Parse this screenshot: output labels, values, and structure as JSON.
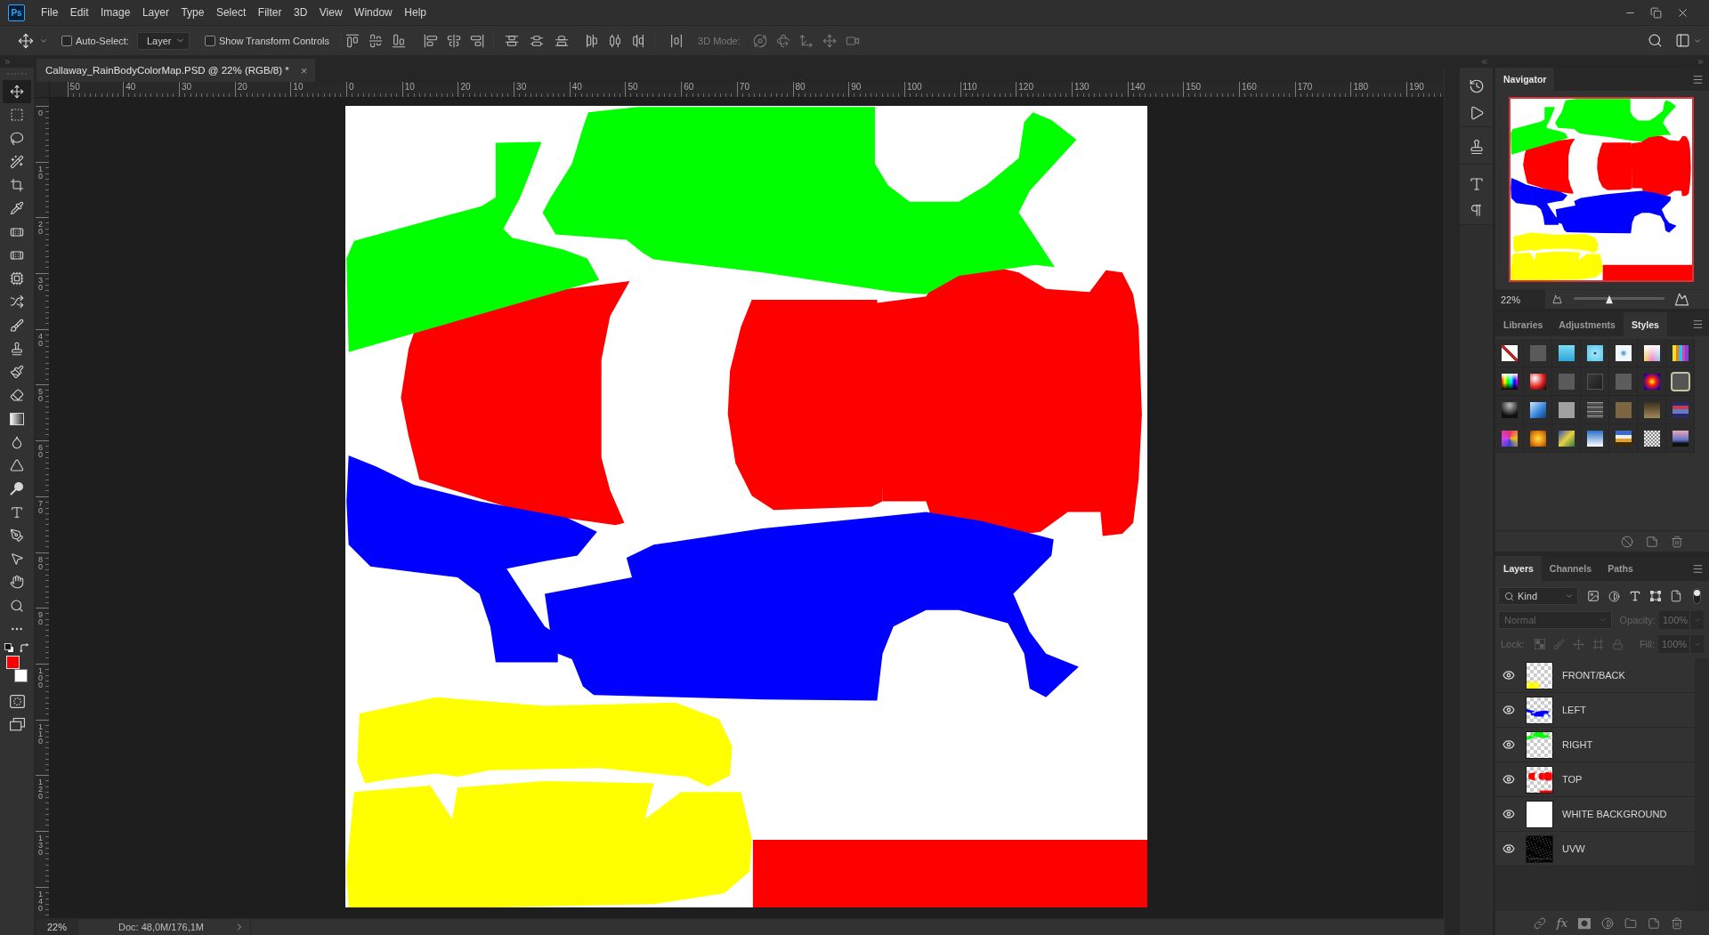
{
  "app_logo": "Ps",
  "menu": [
    "File",
    "Edit",
    "Image",
    "Layer",
    "Type",
    "Select",
    "Filter",
    "3D",
    "View",
    "Window",
    "Help"
  ],
  "options_bar": {
    "auto_select": {
      "label": "Auto-Select:",
      "checked": false
    },
    "target": "Layer",
    "transform_controls": {
      "label": "Show Transform Controls",
      "checked": false
    },
    "mode_label": "3D Mode:"
  },
  "document_tab": {
    "title": "Callaway_RainBodyColorMap.PSD @ 22% (RGB/8) *",
    "close": "×"
  },
  "rulers": {
    "horizontal": [
      "50",
      "40",
      "30",
      "20",
      "10",
      "0",
      "10",
      "20",
      "30",
      "40",
      "50",
      "60",
      "70",
      "80",
      "90",
      "100",
      "110",
      "120",
      "130",
      "140",
      "150",
      "160",
      "170",
      "180",
      "190"
    ],
    "vertical": [
      "0",
      "10",
      "20",
      "30",
      "40",
      "50",
      "60",
      "70",
      "80",
      "90",
      "100",
      "110",
      "120",
      "130",
      "140"
    ]
  },
  "tools": [
    {
      "selected": true
    },
    {
      "selected": false
    },
    {
      "selected": false
    },
    {
      "selected": false
    },
    {
      "selected": false
    },
    {
      "selected": false
    },
    {
      "selected": false
    },
    {
      "selected": false
    },
    {
      "selected": false
    },
    {
      "selected": false
    },
    {
      "selected": false
    },
    {
      "selected": false
    },
    {
      "selected": false
    },
    {
      "selected": false
    },
    {
      "selected": false
    },
    {
      "selected": false
    },
    {
      "selected": false
    },
    {
      "selected": false
    },
    {
      "selected": false
    },
    {
      "selected": false
    },
    {
      "selected": false
    },
    {
      "selected": false
    },
    {
      "selected": false
    },
    {
      "selected": false
    }
  ],
  "color_swatches": [
    {
      "color": "#ff0000"
    },
    {
      "color": "#ffffff"
    }
  ],
  "status_bar": {
    "zoom": "22%",
    "doc_size": "Doc: 48,0M/176,1M"
  },
  "navigator": {
    "title": "Navigator",
    "zoom": "22%",
    "level": 0.39
  },
  "styles_panel": {
    "tabs": [
      {
        "label": "Libraries",
        "selected": false
      },
      {
        "label": "Adjustments",
        "selected": false
      },
      {
        "label": "Styles",
        "selected": true
      }
    ]
  },
  "layers_panel": {
    "tabs": [
      {
        "label": "Layers",
        "selected": true
      },
      {
        "label": "Channels",
        "selected": false
      },
      {
        "label": "Paths",
        "selected": false
      }
    ],
    "filter": {
      "value": "Kind",
      "on": true
    },
    "blend_mode": {
      "value": "Normal",
      "disabled": true
    },
    "opacity": {
      "label": "Opacity:",
      "value": "100%",
      "disabled": true
    },
    "lock": {
      "label": "Lock:",
      "disabled": true
    },
    "fill": {
      "label": "Fill:",
      "value": "100%",
      "disabled": true
    },
    "layers": [
      {
        "name": "FRONT/BACK",
        "visible": true,
        "kind": "shapes"
      },
      {
        "name": "LEFT",
        "visible": true,
        "kind": "shapes"
      },
      {
        "name": "RIGHT",
        "visible": true,
        "kind": "shapes"
      },
      {
        "name": "TOP",
        "visible": true,
        "kind": "shapes"
      },
      {
        "name": "WHITE BACKGROUND",
        "visible": true,
        "kind": "solid"
      },
      {
        "name": "UVW",
        "visible": true,
        "kind": "wireframe"
      }
    ],
    "effects_label": "fx"
  }
}
